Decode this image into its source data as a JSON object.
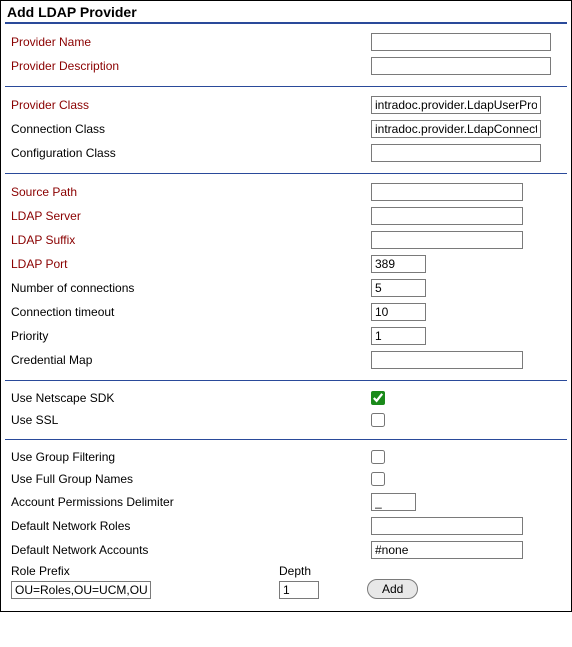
{
  "title": "Add LDAP Provider",
  "section1": {
    "provider_name_label": "Provider Name",
    "provider_name_value": "",
    "provider_description_label": "Provider Description",
    "provider_description_value": ""
  },
  "section2": {
    "provider_class_label": "Provider Class",
    "provider_class_value": "intradoc.provider.LdapUserProvider",
    "connection_class_label": "Connection Class",
    "connection_class_value": "intradoc.provider.LdapConnection",
    "configuration_class_label": "Configuration Class",
    "configuration_class_value": ""
  },
  "section3": {
    "source_path_label": "Source Path",
    "source_path_value": "",
    "ldap_server_label": "LDAP Server",
    "ldap_server_value": "",
    "ldap_suffix_label": "LDAP Suffix",
    "ldap_suffix_value": "",
    "ldap_port_label": "LDAP Port",
    "ldap_port_value": "389",
    "num_connections_label": "Number of connections",
    "num_connections_value": "5",
    "connection_timeout_label": "Connection timeout",
    "connection_timeout_value": "10",
    "priority_label": "Priority",
    "priority_value": "1",
    "credential_map_label": "Credential Map",
    "credential_map_value": ""
  },
  "section4": {
    "use_netscape_sdk_label": "Use Netscape SDK",
    "use_netscape_sdk_checked": true,
    "use_ssl_label": "Use SSL",
    "use_ssl_checked": false
  },
  "section5": {
    "use_group_filtering_label": "Use Group Filtering",
    "use_group_filtering_checked": false,
    "use_full_group_names_label": "Use Full Group Names",
    "use_full_group_names_checked": false,
    "account_permissions_delimiter_label": "Account Permissions Delimiter",
    "account_permissions_delimiter_value": "_",
    "default_network_roles_label": "Default Network Roles",
    "default_network_roles_value": "",
    "default_network_accounts_label": "Default Network Accounts",
    "default_network_accounts_value": "#none"
  },
  "bottom": {
    "role_prefix_label": "Role Prefix",
    "role_prefix_value": "OU=Roles,OU=UCM,OU=C",
    "depth_label": "Depth",
    "depth_value": "1",
    "add_button_label": "Add"
  }
}
